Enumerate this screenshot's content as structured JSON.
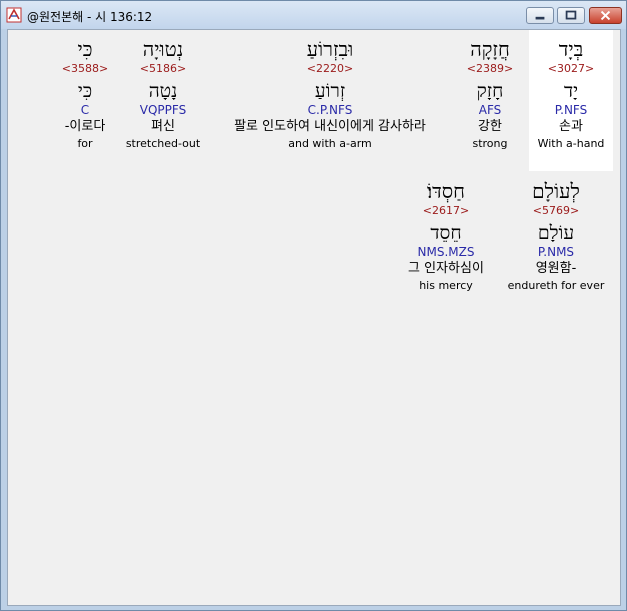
{
  "window": {
    "title": "@원전본해 - 시 136:12",
    "buttons": {
      "minimize": "minimize",
      "maximize": "maximize",
      "close": "close"
    }
  },
  "colors": {
    "strong_number": "#9b1a1a",
    "morphology": "#2a2aa8",
    "highlight_bg": "#ffffff",
    "panel_bg": "#f0f0f0"
  },
  "row1": [
    {
      "hebrew": "בְּיָד",
      "strong": "<3027>",
      "lemma": "יָד",
      "morph": "P.NFS",
      "korean": "손과",
      "english": "With a-hand"
    },
    {
      "hebrew": "חֲזָקָה",
      "strong": "<2389>",
      "lemma": "חָזָק",
      "morph": "AFS",
      "korean": "강한",
      "english": "strong"
    },
    {
      "hebrew": "וּבִזְרוֹעַ",
      "strong": "<2220>",
      "lemma": "זְרוֹעַ",
      "morph": "C.P.NFS",
      "korean": "팔로 인도하여 내신이에게 감사하라",
      "english": "and with a-arm"
    },
    {
      "hebrew": "נְטוּיָה",
      "strong": "<5186>",
      "lemma": "נָטָה",
      "morph": "VQPPFS",
      "korean": "펴신",
      "english": "stretched-out"
    },
    {
      "hebrew": "כִּי",
      "strong": "<3588>",
      "lemma": "כִּי",
      "morph": "C",
      "korean": "-이로다",
      "english": "for"
    }
  ],
  "row2": [
    {
      "hebrew": "לְעוֹלָם",
      "strong": "<5769>",
      "lemma": "עוֹלָם",
      "morph": "P.NMS",
      "korean": "영원함-",
      "english": "endureth for ever"
    },
    {
      "hebrew": "חַסְדּוֹ׃",
      "strong": "<2617>",
      "lemma": "חֵסֵד",
      "morph": "NMS.MZS",
      "korean": "그 인자하심이",
      "english": "his mercy"
    }
  ]
}
